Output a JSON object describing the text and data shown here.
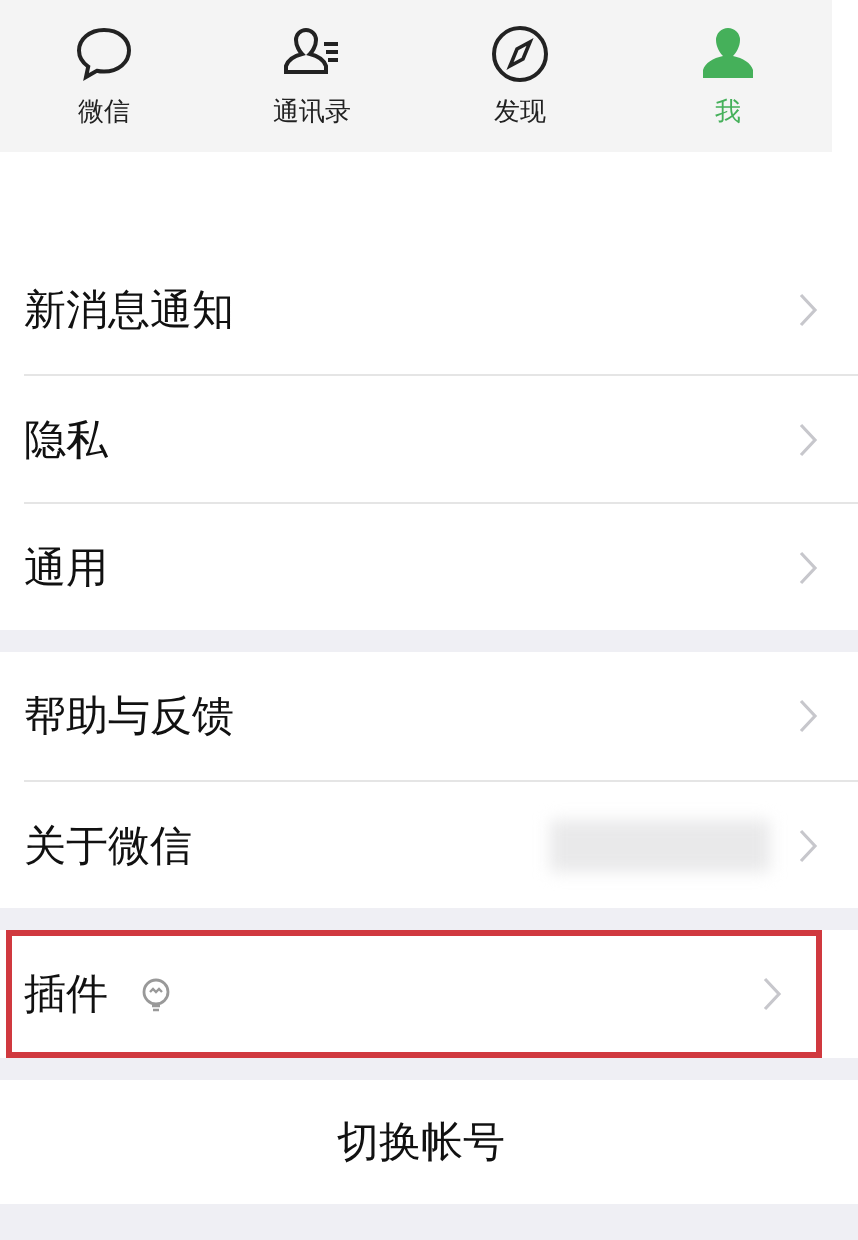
{
  "tabs": [
    {
      "label": "微信",
      "selected": false
    },
    {
      "label": "通讯录",
      "selected": false
    },
    {
      "label": "发现",
      "selected": false
    },
    {
      "label": "我",
      "selected": true
    }
  ],
  "groups": [
    {
      "items": [
        {
          "kind": "row",
          "label": "新消息通知",
          "highlighted": false
        },
        {
          "kind": "row",
          "label": "隐私",
          "highlighted": false
        },
        {
          "kind": "row",
          "label": "通用",
          "highlighted": false
        }
      ]
    },
    {
      "items": [
        {
          "kind": "row",
          "label": "帮助与反馈",
          "highlighted": false
        },
        {
          "kind": "blurred",
          "label": "关于微信",
          "highlighted": false
        }
      ]
    },
    {
      "items": [
        {
          "kind": "icon",
          "label": "插件",
          "highlighted": true
        }
      ]
    },
    {
      "items": [
        {
          "kind": "button",
          "label": "切换帐号",
          "highlighted": false
        }
      ]
    }
  ]
}
